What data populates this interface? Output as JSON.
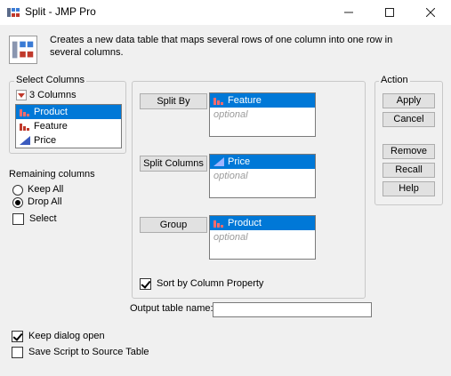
{
  "window": {
    "title": "Split - JMP Pro",
    "minimize_icon": "minimize-icon",
    "maximize_icon": "maximize-icon",
    "close_icon": "close-icon"
  },
  "description": "Creates a new data table that maps several rows of one column into one row in several columns.",
  "select_columns": {
    "legend": "Select Columns",
    "count_label": "3 Columns",
    "items": [
      {
        "label": "Product",
        "icon": "nominal-bar-icon",
        "selected": true
      },
      {
        "label": "Feature",
        "icon": "nominal-bar-icon",
        "selected": false
      },
      {
        "label": "Price",
        "icon": "continuous-triangle-icon",
        "selected": false
      }
    ]
  },
  "remaining_columns": {
    "label": "Remaining columns",
    "options": [
      {
        "label": "Keep All",
        "checked": false
      },
      {
        "label": "Drop All",
        "checked": true
      }
    ],
    "select_label": "Select",
    "select_checked": false
  },
  "roles": [
    {
      "button": "Split By",
      "item": "Feature",
      "placeholder": "optional"
    },
    {
      "button": "Split Columns",
      "item": "Price",
      "placeholder": "optional"
    },
    {
      "button": "Group",
      "item": "Product",
      "placeholder": "optional"
    }
  ],
  "sort_by_column_property": {
    "label": "Sort by Column Property",
    "checked": true
  },
  "output_table_name": {
    "label": "Output table name:",
    "value": ""
  },
  "action": {
    "legend": "Action",
    "apply": "Apply",
    "cancel": "Cancel",
    "remove": "Remove",
    "recall": "Recall",
    "help": "Help"
  },
  "keep_dialog_open": {
    "label": "Keep dialog open",
    "checked": true
  },
  "save_script": {
    "label": "Save Script to Source Table",
    "checked": false
  },
  "colors": {
    "selection": "#0078d7",
    "nominal_icon": "#c0392b",
    "continuous_icon": "#3b5bbf"
  }
}
